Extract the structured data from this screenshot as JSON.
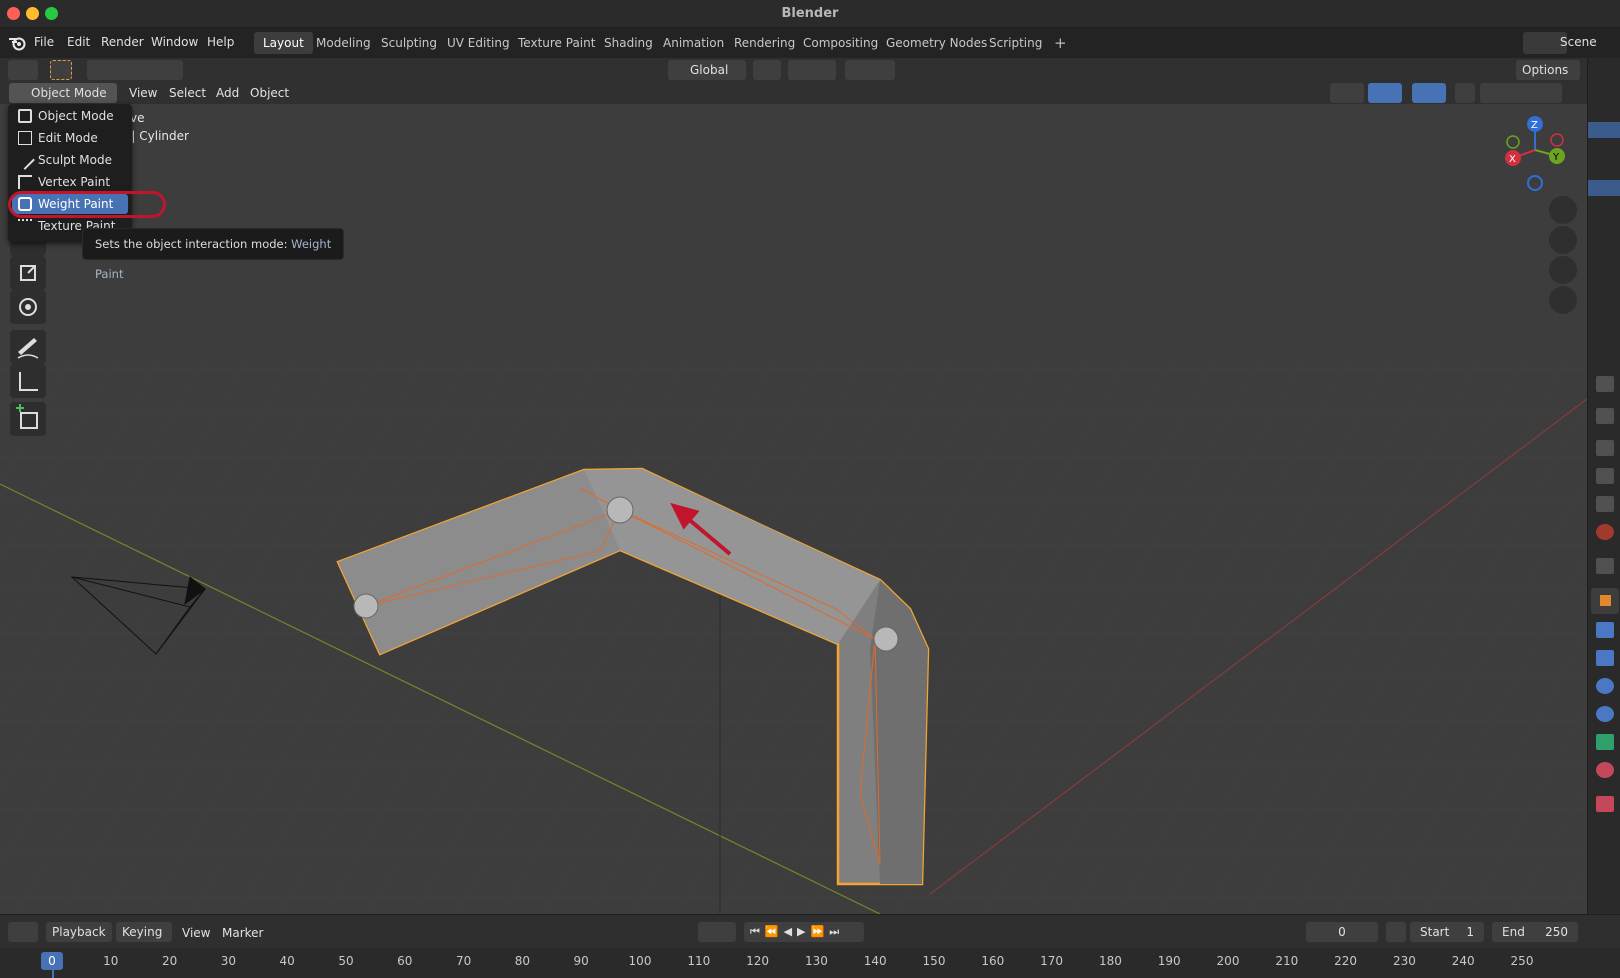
{
  "app": {
    "title": "Blender"
  },
  "menubar": {
    "items": [
      "File",
      "Edit",
      "Render",
      "Window",
      "Help"
    ],
    "scene": "Scene"
  },
  "workspaces": [
    {
      "label": "Layout",
      "active": true
    },
    {
      "label": "Modeling"
    },
    {
      "label": "Sculpting"
    },
    {
      "label": "UV Editing"
    },
    {
      "label": "Texture Paint"
    },
    {
      "label": "Shading"
    },
    {
      "label": "Animation"
    },
    {
      "label": "Rendering"
    },
    {
      "label": "Compositing"
    },
    {
      "label": "Geometry Nodes"
    },
    {
      "label": "Scripting"
    }
  ],
  "toolheader": {
    "orientation": "Global",
    "options": "Options"
  },
  "viewheader": {
    "mode": "Object Mode",
    "menus": [
      "View",
      "Select",
      "Add",
      "Object"
    ]
  },
  "viewport_overlay": {
    "line1": "ective",
    "line2": "n | Cylinder"
  },
  "mode_dropdown": {
    "items": [
      {
        "label": "Object Mode"
      },
      {
        "label": "Edit Mode"
      },
      {
        "label": "Sculpt Mode"
      },
      {
        "label": "Vertex Paint"
      },
      {
        "label": "Weight Paint",
        "selected": true
      },
      {
        "label": "Texture Paint"
      }
    ]
  },
  "tooltip": {
    "text": "Sets the object interaction mode:",
    "value": "Weight Paint"
  },
  "gizmo": {
    "x": "X",
    "y": "Y",
    "z": "Z"
  },
  "timeline": {
    "playback": "Playback",
    "keying": "Keying",
    "view": "View",
    "marker": "Marker",
    "current_frame": "0",
    "start_label": "Start",
    "start_value": "1",
    "end_label": "End",
    "end_value": "250",
    "ruler_current": "0",
    "ruler": [
      "10",
      "20",
      "30",
      "40",
      "50",
      "60",
      "70",
      "80",
      "90",
      "100",
      "110",
      "120",
      "130",
      "140",
      "150",
      "160",
      "170",
      "180",
      "190",
      "200",
      "210",
      "220",
      "230",
      "240",
      "250"
    ]
  },
  "colors": {
    "accent": "#4772b3",
    "selection": "#f5a431",
    "annotation": "#c0152c"
  }
}
